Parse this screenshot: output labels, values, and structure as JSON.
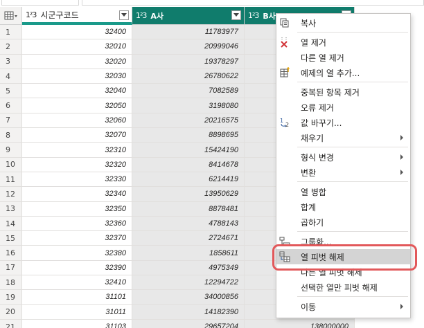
{
  "columns": {
    "row_num_label": "",
    "col1": {
      "type": "1²3",
      "name": "시군구코드"
    },
    "col2": {
      "type": "1²3",
      "name": "A사"
    },
    "col3": {
      "type": "1²3",
      "name": "B사"
    }
  },
  "rows": [
    {
      "n": "1",
      "code": "32400",
      "a": "11783977",
      "b": ""
    },
    {
      "n": "2",
      "code": "32010",
      "a": "20999046",
      "b": ""
    },
    {
      "n": "3",
      "code": "32020",
      "a": "19378297",
      "b": ""
    },
    {
      "n": "4",
      "code": "32030",
      "a": "26780622",
      "b": ""
    },
    {
      "n": "5",
      "code": "32040",
      "a": "7082589",
      "b": ""
    },
    {
      "n": "6",
      "code": "32050",
      "a": "3198080",
      "b": ""
    },
    {
      "n": "7",
      "code": "32060",
      "a": "20216575",
      "b": ""
    },
    {
      "n": "8",
      "code": "32070",
      "a": "8898695",
      "b": ""
    },
    {
      "n": "9",
      "code": "32310",
      "a": "15424190",
      "b": ""
    },
    {
      "n": "10",
      "code": "32320",
      "a": "8414678",
      "b": ""
    },
    {
      "n": "11",
      "code": "32330",
      "a": "6214419",
      "b": ""
    },
    {
      "n": "12",
      "code": "32340",
      "a": "13950629",
      "b": ""
    },
    {
      "n": "13",
      "code": "32350",
      "a": "8878481",
      "b": ""
    },
    {
      "n": "14",
      "code": "32360",
      "a": "4788143",
      "b": ""
    },
    {
      "n": "15",
      "code": "32370",
      "a": "2724671",
      "b": ""
    },
    {
      "n": "16",
      "code": "32380",
      "a": "1858611",
      "b": ""
    },
    {
      "n": "17",
      "code": "32390",
      "a": "4975349",
      "b": ""
    },
    {
      "n": "18",
      "code": "32410",
      "a": "12294722",
      "b": ""
    },
    {
      "n": "19",
      "code": "31101",
      "a": "34000856",
      "b": ""
    },
    {
      "n": "20",
      "code": "31011",
      "a": "14182390",
      "b": ""
    },
    {
      "n": "21",
      "code": "31103",
      "a": "29657204",
      "b": "138000000"
    }
  ],
  "menu": {
    "copy": "복사",
    "remove_column": "열 제거",
    "remove_other_columns": "다른 열 제거",
    "add_column_from_examples": "예제의 열 추가...",
    "remove_duplicates": "중복된 항목 제거",
    "remove_errors": "오류 제거",
    "replace_values": "값 바꾸기...",
    "fill": "채우기",
    "change_type": "형식 변경",
    "transform": "변환",
    "merge_columns": "열 병합",
    "sum": "합계",
    "multiply": "곱하기",
    "group_by": "그룹화...",
    "unpivot_columns": "열 피벗 해제",
    "unpivot_other_columns": "다른 열 피벗 해제",
    "unpivot_only_selected": "선택한 열만 피벗 해제",
    "move": "이동"
  },
  "colors": {
    "header_selected": "#107c6c",
    "callout": "#e2585a",
    "highlight": "#d4d4d4"
  }
}
